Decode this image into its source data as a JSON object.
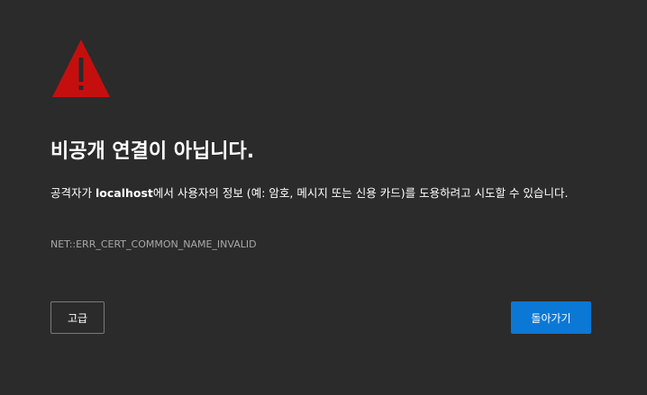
{
  "icon": "warning-triangle-icon",
  "colors": {
    "background": "#2b2b2b",
    "warning": "#c50f0f",
    "primary_button": "#0b78d6",
    "muted_text": "#a8a8a8"
  },
  "error": {
    "title": "비공개 연결이 아닙니다.",
    "description_before": "공격자가 ",
    "host": "localhost",
    "description_after": "에서 사용자의 정보 (예: 암호, 메시지 또는 신용 카드)를 도용하려고 시도할 수 있습니다.",
    "code": "NET::ERR_CERT_COMMON_NAME_INVALID"
  },
  "buttons": {
    "advanced": "고급",
    "back": "돌아가기"
  }
}
